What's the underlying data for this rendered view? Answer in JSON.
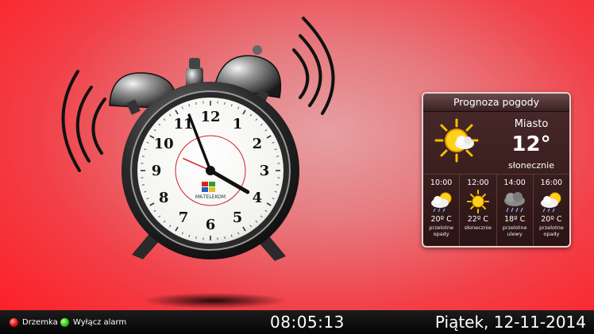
{
  "clock": {
    "brand_text": "MK-TELEKOM",
    "numerals": [
      "12",
      "1",
      "2",
      "3",
      "4",
      "5",
      "6",
      "7",
      "8",
      "9",
      "10",
      "11"
    ],
    "hour_hand_value": "4",
    "minute_hand_value": "11"
  },
  "weather": {
    "title": "Prognoza pogody",
    "city": "Miasto",
    "temperature": "12°",
    "condition": "słonecznie",
    "current_icon": "sun-cloud-icon",
    "forecast": [
      {
        "time": "10:00",
        "icon": "cloud-sun-rain-icon",
        "temp": "20º C",
        "desc": "przelotne opady"
      },
      {
        "time": "12:00",
        "icon": "sun-icon",
        "temp": "22º C",
        "desc": "słonecznie"
      },
      {
        "time": "14:00",
        "icon": "storm-cloud-icon",
        "temp": "18º C",
        "desc": "przelotne ulewy"
      },
      {
        "time": "16:00",
        "icon": "cloud-sun-rain-icon",
        "temp": "20º C",
        "desc": "przelotne opady"
      }
    ]
  },
  "bottombar": {
    "snooze_label": "Drzemka",
    "alarm_off_label": "Wyłącz alarm",
    "time": "08:05:13",
    "date": "Piątek, 12-11-2014"
  },
  "colors": {
    "background": "#ff1a22",
    "snooze_dot": "#e01010",
    "alarm_off_dot": "#2cc810"
  }
}
